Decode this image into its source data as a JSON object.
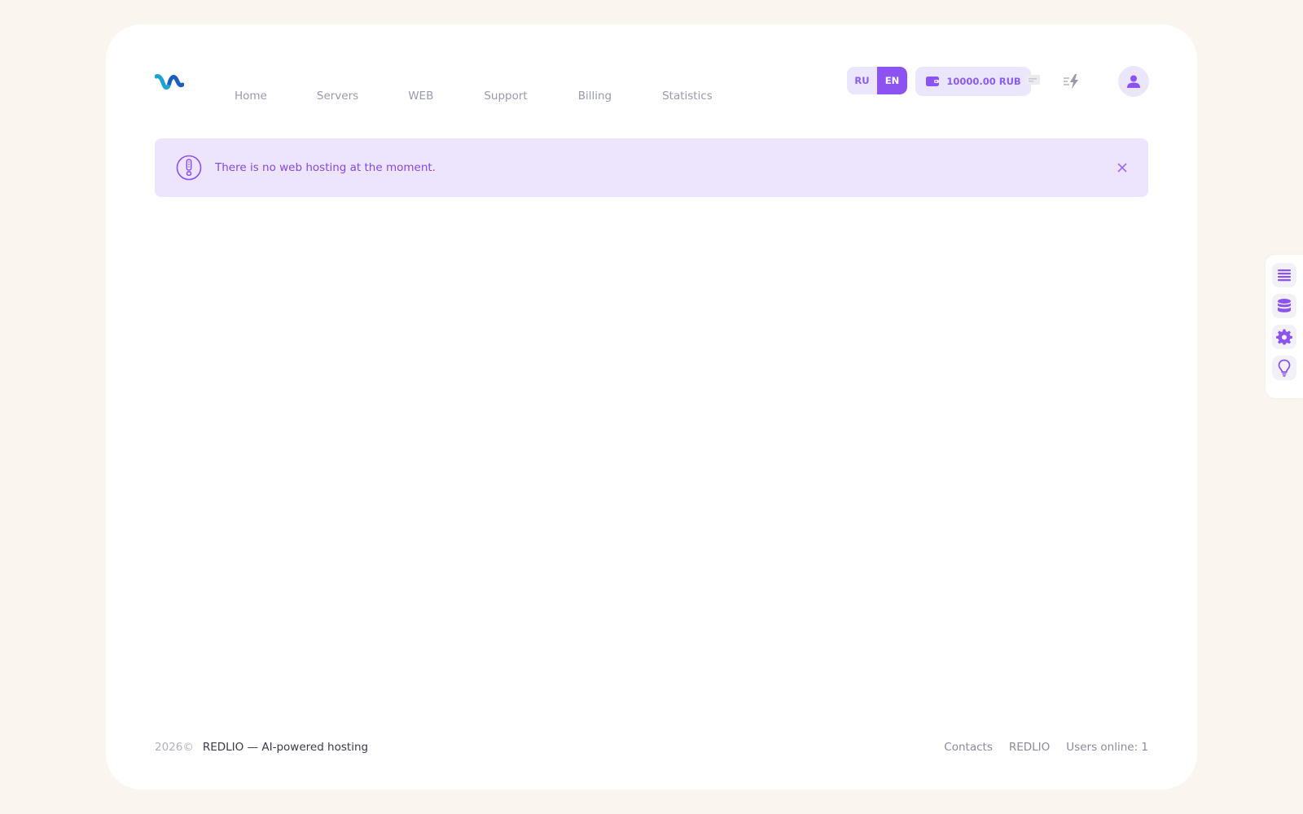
{
  "app": {
    "logo_name": "logo-icon"
  },
  "nav": {
    "items": [
      {
        "label": "Home"
      },
      {
        "label": "Servers"
      },
      {
        "label": "WEB"
      },
      {
        "label": "Support"
      },
      {
        "label": "Billing"
      },
      {
        "label": "Statistics"
      }
    ]
  },
  "language": {
    "options": [
      "RU",
      "EN"
    ],
    "selected": "EN"
  },
  "balance": {
    "label": "10000.00 RUB",
    "icon": "wallet-icon"
  },
  "header_icons": {
    "chat": "chat-icon",
    "activity": "lightning-icon",
    "profile": "user-icon"
  },
  "alert": {
    "text": "There is no web hosting at the moment.",
    "icon": "exclamation-icon",
    "close_icon": "close-icon"
  },
  "footer": {
    "year": "2026©",
    "tagline": "REDLIO — AI-powered hosting",
    "links": [
      "Contacts",
      "REDLIO"
    ],
    "users_online": "Users online: 1"
  },
  "side_dock": {
    "icons": [
      "list-icon",
      "database-icon",
      "gear-icon",
      "lightbulb-icon"
    ]
  },
  "colors": {
    "background": "#faf6ef",
    "accent": "#8c52f2",
    "accent_soft": "#ece6fc",
    "alert_bg": "#ede5fd",
    "muted_text": "#9a9aae"
  }
}
